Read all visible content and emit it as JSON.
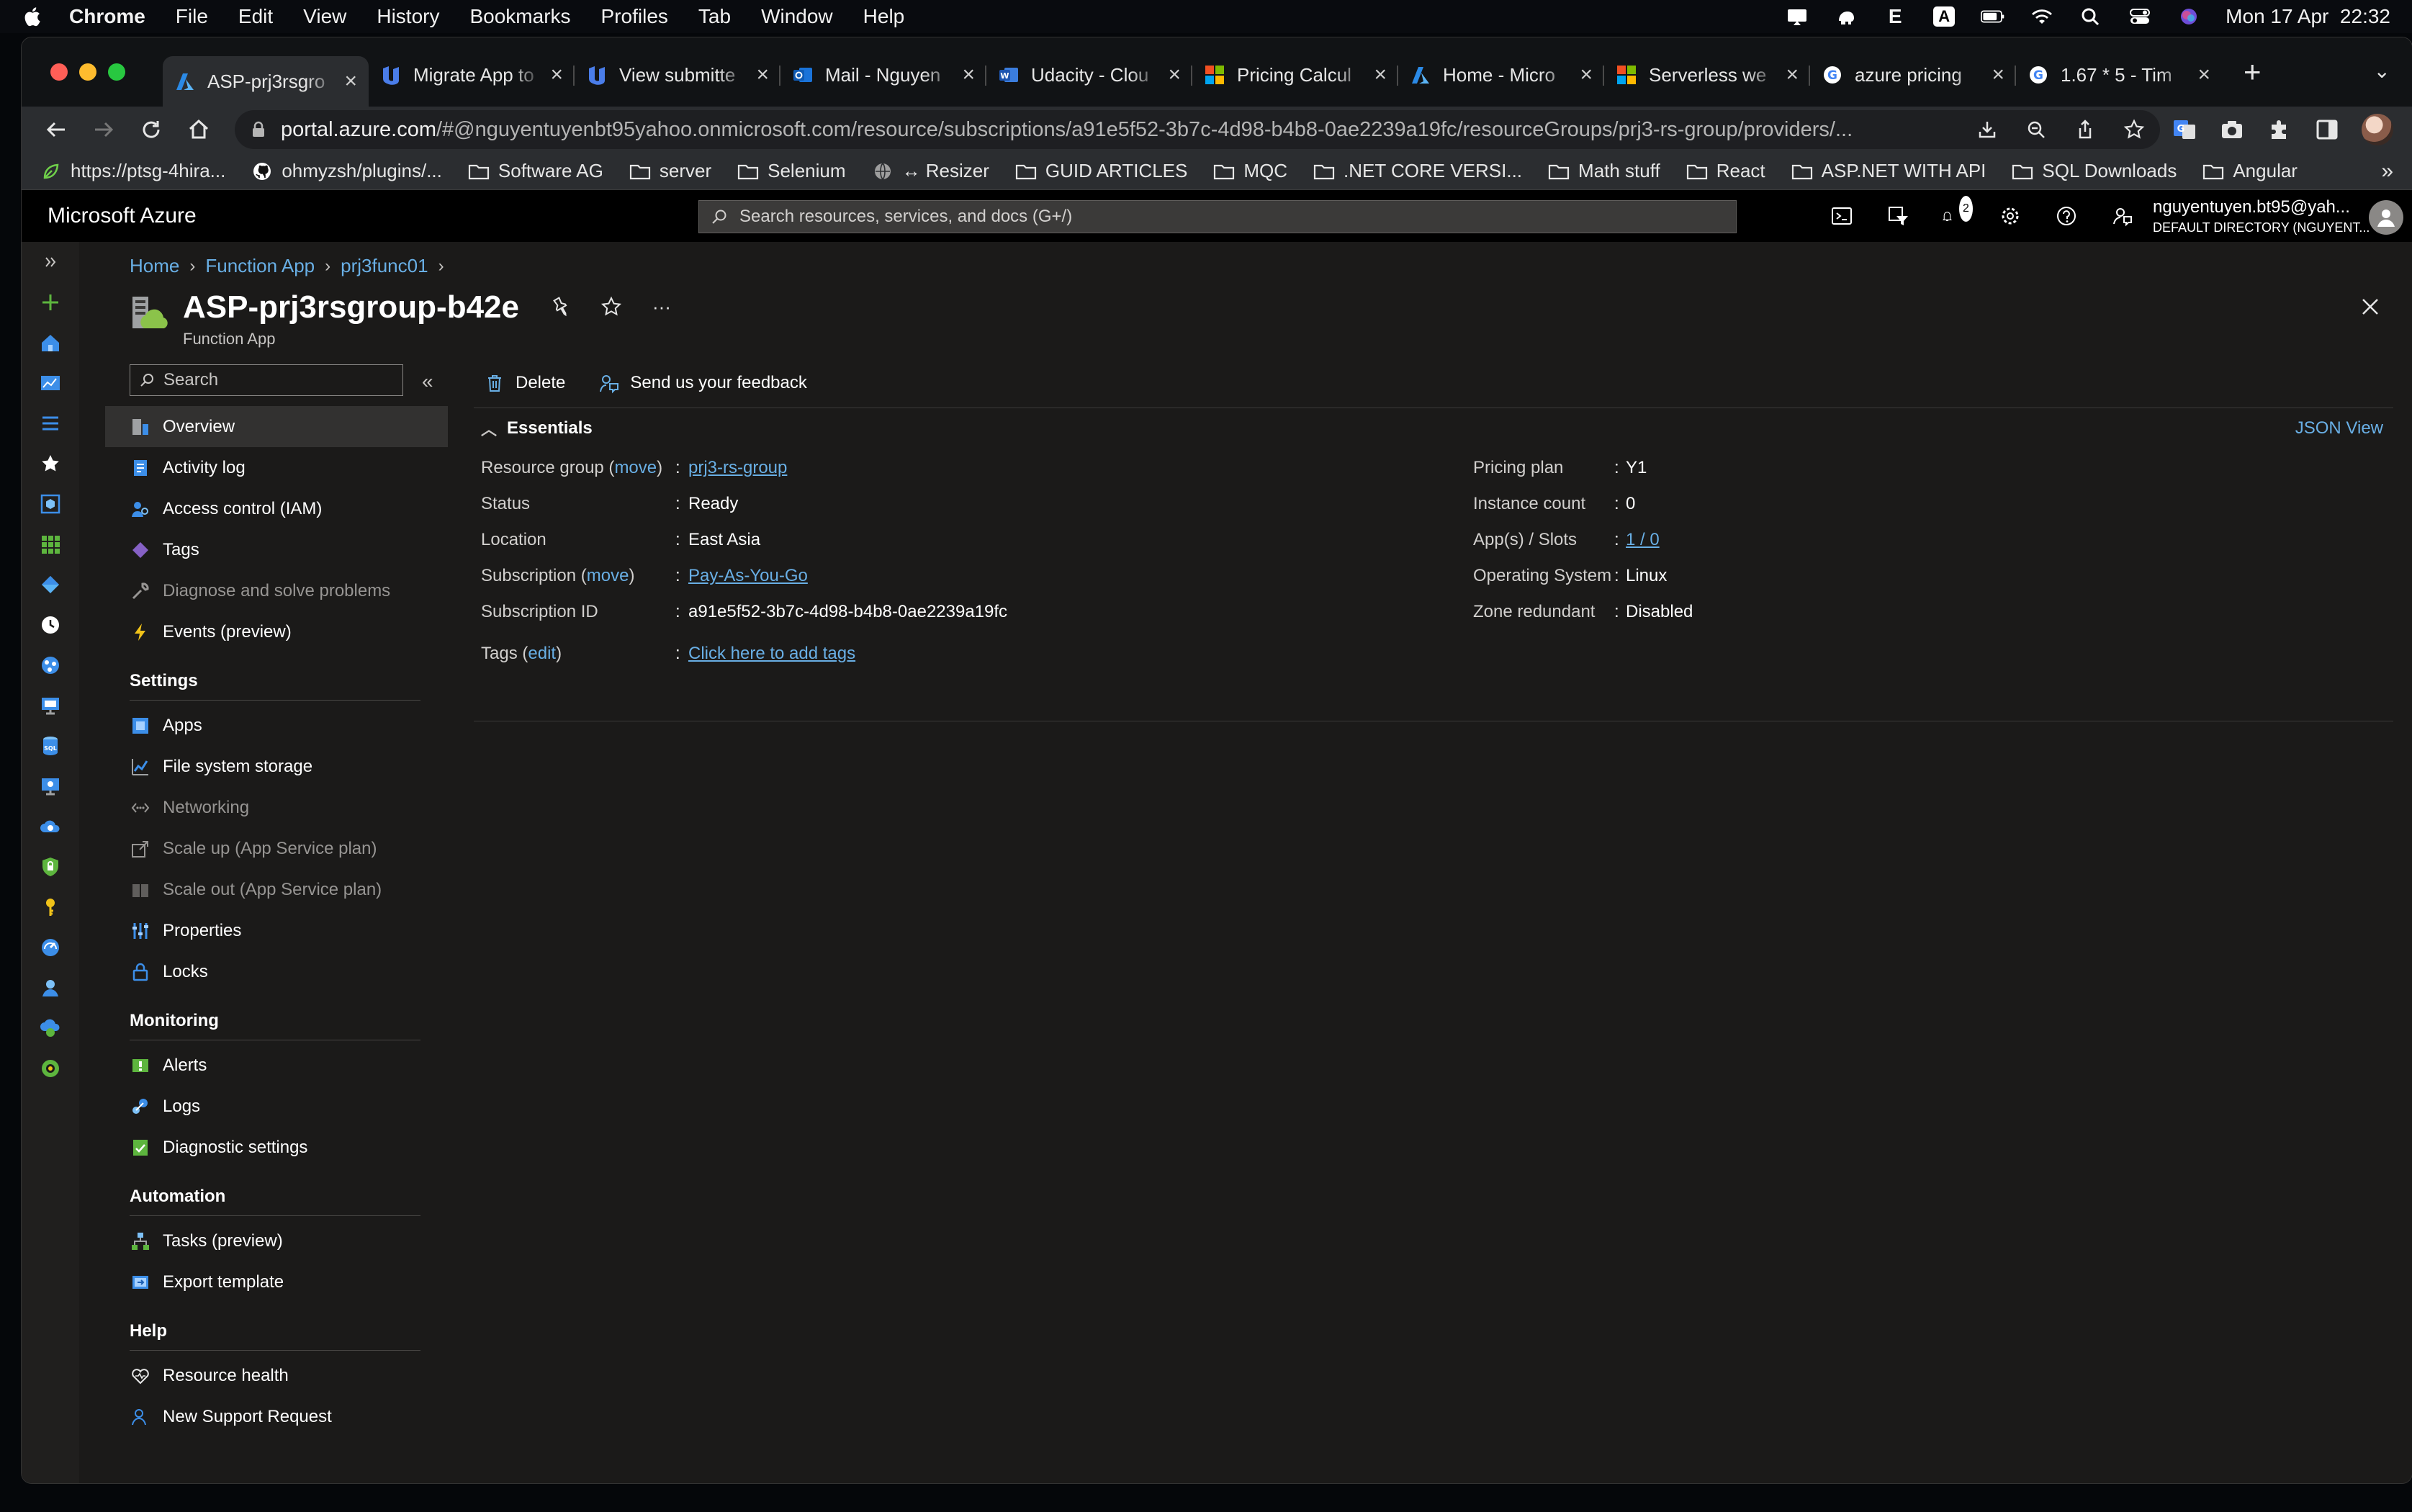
{
  "menubar": {
    "app": "Chrome",
    "items": [
      "File",
      "Edit",
      "View",
      "History",
      "Bookmarks",
      "Profiles",
      "Tab",
      "Window",
      "Help"
    ],
    "clock": "Mon 17 Apr  22:32",
    "status_letter_e": "E",
    "status_letter_a": "A"
  },
  "tabs": [
    {
      "title": "ASP-prj3rsgro",
      "icon": "azure-icon",
      "active": true
    },
    {
      "title": "Migrate App to",
      "icon": "udacity-icon"
    },
    {
      "title": "View submitte",
      "icon": "udacity-icon"
    },
    {
      "title": "Mail - Nguyen",
      "icon": "outlook-icon"
    },
    {
      "title": "Udacity - Clou",
      "icon": "word-icon"
    },
    {
      "title": "Pricing Calcul",
      "icon": "microsoft-icon"
    },
    {
      "title": "Home - Micro",
      "icon": "azure-icon"
    },
    {
      "title": "Serverless we",
      "icon": "microsoft-icon"
    },
    {
      "title": "azure pricing",
      "icon": "google-icon"
    },
    {
      "title": "1.67 * 5 - Tim",
      "icon": "google-icon"
    }
  ],
  "address": {
    "host": "portal.azure.com",
    "path": "/#@nguyentuyenbt95yahoo.onmicrosoft.com/resource/subscriptions/a91e5f52-3b7c-4d98-b4b8-0ae2239a19fc/resourceGroups/prj3-rs-group/providers/..."
  },
  "bookmarks": [
    {
      "label": "https://ptsg-4hira...",
      "icon": "leaf-icon"
    },
    {
      "label": "ohmyzsh/plugins/...",
      "icon": "github-icon"
    },
    {
      "label": "Software AG",
      "icon": "folder-icon"
    },
    {
      "label": "server",
      "icon": "folder-icon"
    },
    {
      "label": "Selenium",
      "icon": "folder-icon"
    },
    {
      "label": "↔ Resizer",
      "icon": "globe-icon"
    },
    {
      "label": "GUID ARTICLES",
      "icon": "folder-icon"
    },
    {
      "label": "MQC",
      "icon": "folder-icon"
    },
    {
      "label": ".NET CORE VERSI...",
      "icon": "folder-icon"
    },
    {
      "label": "Math stuff",
      "icon": "folder-icon"
    },
    {
      "label": "React",
      "icon": "folder-icon"
    },
    {
      "label": "ASP.NET WITH API",
      "icon": "folder-icon"
    },
    {
      "label": "SQL Downloads",
      "icon": "folder-icon"
    },
    {
      "label": "Angular",
      "icon": "folder-icon"
    }
  ],
  "bookmarks_more": "»",
  "azure": {
    "brand": "Microsoft Azure",
    "search_placeholder": "Search resources, services, and docs (G+/)",
    "notifications_count": "2",
    "user_name": "nguyentuyen.bt95@yah...",
    "user_directory": "DEFAULT DIRECTORY (NGUYENT..."
  },
  "breadcrumbs": [
    "Home",
    "Function App",
    "prj3func01"
  ],
  "resource": {
    "title": "ASP-prj3rsgroup-b42e",
    "subtitle": "Function App",
    "more": "···"
  },
  "sidenav": {
    "search_placeholder": "Search",
    "collapse": "«",
    "top_items": [
      {
        "label": "Overview",
        "icon": "overview-icon",
        "active": true
      },
      {
        "label": "Activity log",
        "icon": "activity-log-icon"
      },
      {
        "label": "Access control (IAM)",
        "icon": "iam-icon"
      },
      {
        "label": "Tags",
        "icon": "tag-icon"
      },
      {
        "label": "Diagnose and solve problems",
        "icon": "wrench-icon",
        "dim": true
      },
      {
        "label": "Events (preview)",
        "icon": "lightning-icon"
      }
    ],
    "settings_header": "Settings",
    "settings_items": [
      {
        "label": "Apps",
        "icon": "apps-icon"
      },
      {
        "label": "File system storage",
        "icon": "chart-icon"
      },
      {
        "label": "Networking",
        "icon": "network-icon",
        "dim": true
      },
      {
        "label": "Scale up (App Service plan)",
        "icon": "scale-up-icon",
        "dim": true
      },
      {
        "label": "Scale out (App Service plan)",
        "icon": "scale-out-icon",
        "dim": true
      },
      {
        "label": "Properties",
        "icon": "properties-icon"
      },
      {
        "label": "Locks",
        "icon": "lock-icon"
      }
    ],
    "monitoring_header": "Monitoring",
    "monitoring_items": [
      {
        "label": "Alerts",
        "icon": "alert-icon"
      },
      {
        "label": "Logs",
        "icon": "logs-icon"
      },
      {
        "label": "Diagnostic settings",
        "icon": "diagnostic-icon"
      }
    ],
    "automation_header": "Automation",
    "automation_items": [
      {
        "label": "Tasks (preview)",
        "icon": "tasks-icon"
      },
      {
        "label": "Export template",
        "icon": "export-icon"
      }
    ],
    "help_header": "Help",
    "help_items": [
      {
        "label": "Resource health",
        "icon": "heart-icon"
      },
      {
        "label": "New Support Request",
        "icon": "support-icon"
      }
    ]
  },
  "commands": {
    "delete": "Delete",
    "feedback": "Send us your feedback"
  },
  "essentials": {
    "header": "Essentials",
    "json_view": "JSON View",
    "resource_group_label": "Resource group",
    "move": "move",
    "resource_group_value": "prj3-rs-group",
    "status_label": "Status",
    "status_value": "Ready",
    "location_label": "Location",
    "location_value": "East Asia",
    "subscription_label": "Subscription",
    "subscription_value": "Pay-As-You-Go",
    "subscription_id_label": "Subscription ID",
    "subscription_id_value": "a91e5f52-3b7c-4d98-b4b8-0ae2239a19fc",
    "tags_label": "Tags",
    "edit": "edit",
    "tags_value": "Click here to add tags",
    "pricing_plan_label": "Pricing plan",
    "pricing_plan_value": "Y1",
    "instance_count_label": "Instance count",
    "instance_count_value": "0",
    "apps_slots_label": "App(s) / Slots",
    "apps_slots_value": "1 / 0",
    "os_label": "Operating System",
    "os_value": "Linux",
    "zone_label": "Zone redundant",
    "zone_value": "Disabled"
  },
  "colors": {
    "accent": "#69afe5",
    "background": "#1b1a19"
  }
}
